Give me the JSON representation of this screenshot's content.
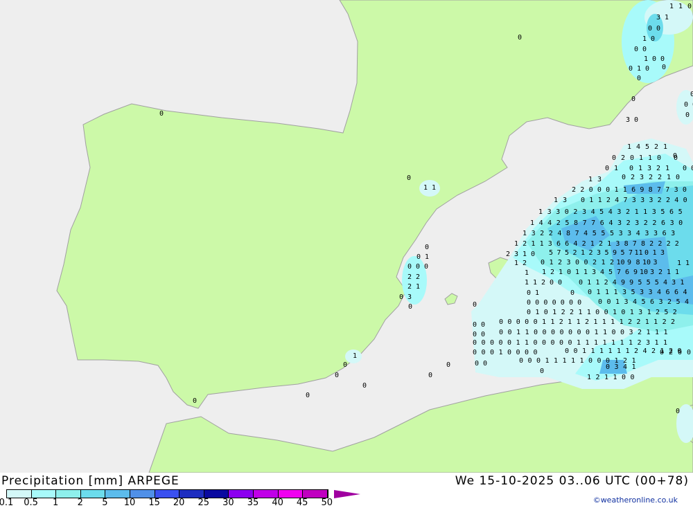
{
  "title": "Precipitation [mm] ARPEGE",
  "valid_time": "We 15-10-2025 03..06 UTC (00+78)",
  "credit": "©weatheronline.co.uk",
  "colors": {
    "land": "#ccf9a8",
    "sea": "#eeeeee",
    "coast": "#a0a0a0"
  },
  "legend": {
    "ticks": [
      "0.1",
      "0.5",
      "1",
      "2",
      "5",
      "10",
      "15",
      "20",
      "25",
      "30",
      "35",
      "40",
      "45",
      "50"
    ],
    "colors": [
      "#d4f8f8",
      "#a8fafa",
      "#8ef0ec",
      "#6cdcec",
      "#5cbcec",
      "#5090e8",
      "#3a50f0",
      "#1e2ec0",
      "#0a0aa0",
      "#8c00f0",
      "#c000e8",
      "#f000f0",
      "#c000c0"
    ]
  },
  "values": [
    "1 4 5 2 1",
    "0 2 0 1 1 0",
    "0",
    "0 1",
    "0 1 3 2 1",
    "0 0",
    "1 3",
    "0 2 3 2 2 1 0",
    "2 2 0 0 0 1 1 6 9 8 7 7 3 0",
    "1 3",
    "0 1 1 2 4 7 3 3 3 2 2 4 0",
    "1 3 3 0 2 3 4 5 4 3 2 1 1 3 5 6 5",
    "1 4 4 2 5 8 7 7 6 4 3 2 3 2 2 6 3 0",
    "1 3 2 2 4 8 7 4 5 5 5 3 3 4 3 3 6 3",
    "1 2 1 1 3 6 6 4 2 1 2 1 3 8 7 8 2 2 2 2",
    "2 3 1 0",
    "5 7 5 2 1 2 3 5 9 5 7 11 0 1 3",
    "1 2",
    "0 1 2 3 0 0 2 1 2 10 9 8 10 3",
    "1 1",
    "1",
    "1 2 1 0 1 1 3 4 5 7 6 9 10 3 2 1 1",
    "1 1 2 0 0",
    "0 1 1 2 4 9 9 5 5 5 4 3 1",
    "0 1",
    "0",
    "0 1 1 1 3 5 3 3 4 6 6 4",
    "0 0 0 0 0 0 0",
    "0 0 1 3 4 5 6 3 2 5 4",
    "0 1 0 1 2 2 1 1 0 0 1 0 1 3 1 2 5 2",
    "0",
    "0 0",
    "0 0 0 0 0 1 1 2 1 1 2 1 1 1 1 2 2 1 1 2 2",
    "0 0",
    "0 0 1 1 0 0 0 0 0 0 0 1 1 0 0 3 2 1 1 1",
    "0 0 0 0 0 1 1 0 0 0 0 0 1 1 1 1 1 1 1 2 3 1 1",
    "0 0 0 1 0 0 0 0",
    "0 0 1 1 1 1 1 1 2 4 2 1 2 0",
    "0 0",
    "0 0 0 1 1 1 1 1 0 0 0 1 2 1",
    "0 2 0 0",
    "0",
    "0 3 4 1",
    "1 2 1 1 0 0",
    "0",
    "0",
    "0",
    "1 1",
    "0",
    "0 1",
    "0 0 0",
    "2 2",
    "2 1",
    "0 3",
    "0",
    "1",
    "0",
    "0",
    "0",
    "0",
    "0",
    "0",
    "0",
    "0",
    "3 0",
    "1 1 0",
    "3 1",
    "0 0",
    "1 0",
    "0 0",
    "1 0 0",
    "0 1 0",
    "0",
    "0",
    "0",
    "0",
    "0 0",
    "0 0",
    "0"
  ]
}
